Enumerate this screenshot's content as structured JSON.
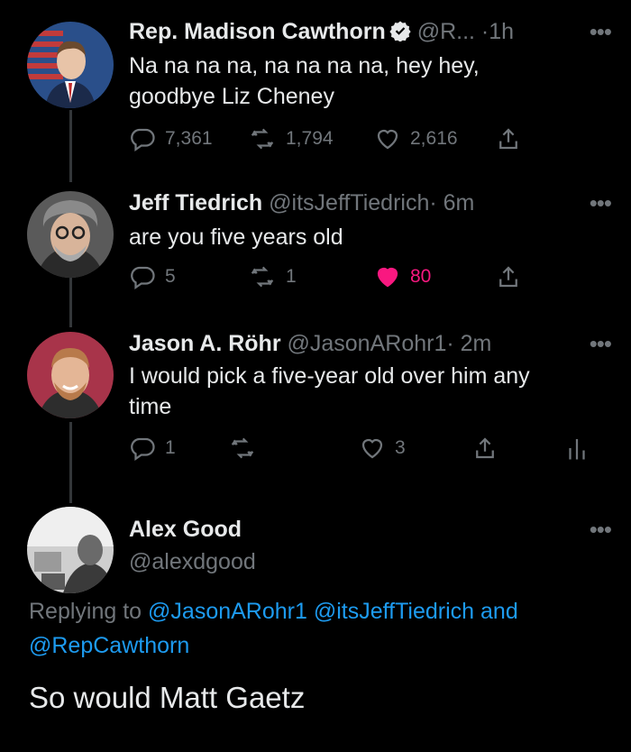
{
  "tweets": [
    {
      "name": "Rep. Madison Cawthorn",
      "handle": "@R...",
      "dot": "·",
      "time": "1h",
      "text_lines": [
        "Na na na na, na na na na, hey hey,",
        "goodbye Liz Cheney"
      ],
      "replies": "7,361",
      "retweets": "1,794",
      "likes": "2,616"
    },
    {
      "name": "Jeff Tiedrich",
      "handle": "@itsJeffTiedrich",
      "dot": "·",
      "time": "6m",
      "text_lines": [
        "are you five years old"
      ],
      "replies": "5",
      "retweets": "1",
      "likes": "80"
    },
    {
      "name": "Jason A. Röhr",
      "handle": "@JasonARohr1",
      "dot": "·",
      "time": "2m",
      "text_lines": [
        "I would pick a five-year old over him any",
        "time"
      ],
      "replies": "1",
      "retweets": "",
      "likes": "3"
    }
  ],
  "main": {
    "name": "Alex Good",
    "handle": "@alexdgood",
    "replying_prefix": "Replying to",
    "mention_1": "@JasonARohr1",
    "mention_2": "@itsJeffTiedrich",
    "and": "and",
    "mention_3": "@RepCawthorn",
    "text": "So would Matt Gaetz"
  },
  "more_glyph": "•••",
  "colors": {
    "background": "#000000",
    "secondary": "#71767b",
    "link": "#1d9bf0",
    "like": "#f91880",
    "verified": "#e7e9ea"
  },
  "icons": [
    "reply-icon",
    "retweet-icon",
    "like-icon",
    "share-icon",
    "analytics-icon",
    "verified-icon",
    "more-icon"
  ]
}
